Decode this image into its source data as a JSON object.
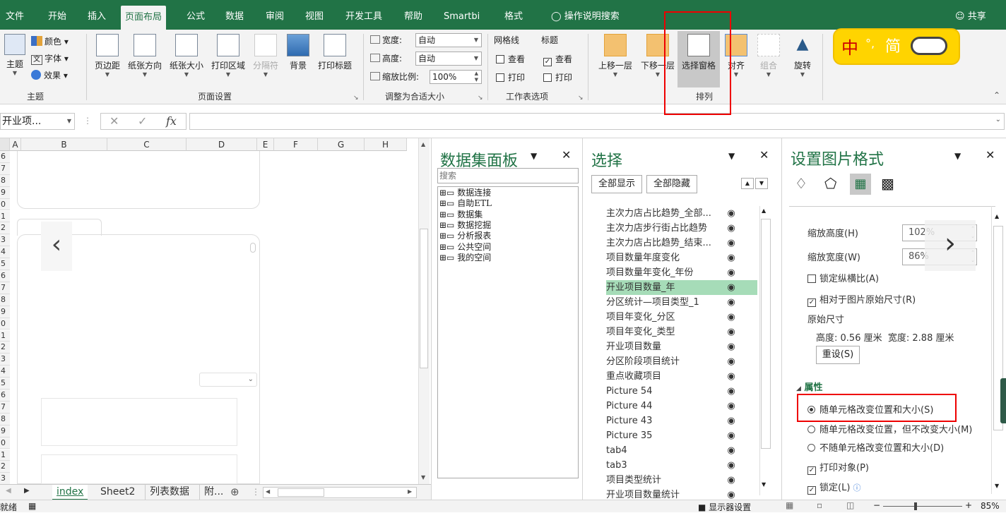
{
  "tabs": [
    "文件",
    "开始",
    "插入",
    "页面布局",
    "公式",
    "数据",
    "审阅",
    "视图",
    "开发工具",
    "帮助",
    "Smartbi",
    "格式"
  ],
  "active_tab_index": 3,
  "tell_me": "操作说明搜索",
  "share": "共享",
  "ime": {
    "lang": "中",
    "mode": "简"
  },
  "ribbon": {
    "theme_group": {
      "theme_label": "主题",
      "colors": "颜色",
      "fonts": "字体",
      "effects": "效果",
      "group_label": "主题"
    },
    "page_setup": {
      "buttons": [
        "页边距",
        "纸张方向",
        "纸张大小",
        "打印区域",
        "分隔符",
        "背景",
        "打印标题"
      ],
      "group_label": "页面设置"
    },
    "scale": {
      "width_label": "宽度:",
      "width_value": "自动",
      "height_label": "高度:",
      "height_value": "自动",
      "scale_label": "缩放比例:",
      "scale_value": "100%",
      "group_label": "调整为合适大小"
    },
    "sheet_options": {
      "gridlines": "网格线",
      "headings": "标题",
      "view": "查看",
      "print": "打印",
      "group_label": "工作表选项"
    },
    "arrange": {
      "buttons": [
        "上移一层",
        "下移一层",
        "选择窗格",
        "对齐",
        "组合",
        "旋转"
      ],
      "group_label": "排列"
    }
  },
  "formula_bar": {
    "name_box": "开业项...",
    "fx": "fx"
  },
  "columns": [
    "A",
    "B",
    "C",
    "D",
    "E",
    "F",
    "G",
    "H"
  ],
  "rows": [
    "6",
    "7",
    "8",
    "9",
    "0",
    "1",
    "2",
    "3",
    "4",
    "5",
    "6",
    "7",
    "8",
    "9",
    "0",
    "1",
    "2",
    "3",
    "4",
    "5",
    "6",
    "7",
    "8",
    "9",
    "0",
    "1",
    "2",
    "3",
    "4"
  ],
  "dataset_panel": {
    "title": "数据集面板",
    "search_placeholder": "搜索",
    "items": [
      "数据连接",
      "自助ETL",
      "数据集",
      "数据挖掘",
      "分析报表",
      "公共空间",
      "我的空间"
    ]
  },
  "selection_pane": {
    "title": "选择",
    "show_all": "全部显示",
    "hide_all": "全部隐藏",
    "items": [
      "主次力店占比趋势_全部...",
      "主次力店步行街占比趋势",
      "主次力店占比趋势_结束...",
      "项目数量年度变化",
      "项目数量年变化_年份",
      "开业项目数量_年",
      "分区统计—项目类型_1",
      "项目年变化_分区",
      "项目年变化_类型",
      "开业项目数量",
      "分区阶段项目统计",
      "重点收藏项目",
      "Picture 54",
      "Picture 44",
      "Picture 43",
      "Picture 35",
      "tab4",
      "tab3",
      "项目类型统计",
      "开业项目数量统计"
    ],
    "selected_index": 5
  },
  "format_pane": {
    "title": "设置图片格式",
    "scale_height_label": "缩放高度(H)",
    "scale_height_value": "102%",
    "scale_width_label": "缩放宽度(W)",
    "scale_width_value": "86%",
    "lock_ratio": "锁定纵横比(A)",
    "relative_original": "相对于图片原始尺寸(R)",
    "original_size": "原始尺寸",
    "orig_height_label": "高度:",
    "orig_height_value": "0.56 厘米",
    "orig_width_label": "宽度:",
    "orig_width_value": "2.88 厘米",
    "reset": "重设(S)",
    "properties": "属性",
    "opt1": "随单元格改变位置和大小(S)",
    "opt2": "随单元格改变位置，但不改变大小(M)",
    "opt3": "不随单元格改变位置和大小(D)",
    "print_obj": "打印对象(P)",
    "locked": "锁定(L)"
  },
  "sheet_tabs": [
    "index",
    "Sheet2",
    "列表数据",
    "附..."
  ],
  "status": {
    "ready": "就绪",
    "display": "显示器设置",
    "zoom": "85%"
  },
  "colors": {
    "accent": "#217346",
    "selected_row": "#a6dcb8",
    "highlight_box": "#e00000"
  }
}
